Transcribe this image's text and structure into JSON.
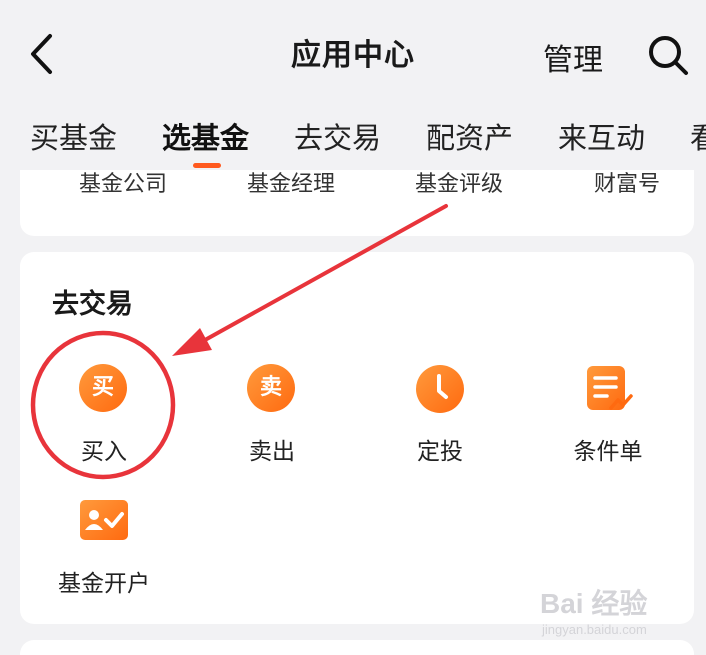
{
  "header": {
    "title": "应用中心",
    "manage_label": "管理"
  },
  "tabs": [
    {
      "label": "买基金",
      "active": false
    },
    {
      "label": "选基金",
      "active": true
    },
    {
      "label": "去交易",
      "active": false
    },
    {
      "label": "配资产",
      "active": false
    },
    {
      "label": "来互动",
      "active": false
    },
    {
      "label": "看",
      "active": false
    }
  ],
  "top_card": {
    "items": [
      "基金公司",
      "基金经理",
      "基金评级",
      "财富号"
    ]
  },
  "trade_section": {
    "title": "去交易",
    "items": [
      {
        "label": "买入",
        "icon_glyph": "买",
        "icon": "buy-icon"
      },
      {
        "label": "卖出",
        "icon_glyph": "卖",
        "icon": "sell-icon"
      },
      {
        "label": "定投",
        "icon": "clock-icon"
      },
      {
        "label": "条件单",
        "icon": "document-chart-icon"
      },
      {
        "label": "基金开户",
        "icon": "account-verified-icon"
      }
    ]
  },
  "watermark": {
    "brand": "Bai 经验",
    "url": "jingyan.baidu.com"
  },
  "colors": {
    "accent": "#ff6a10",
    "annotation": "#e8343b",
    "background": "#f2f2f4"
  }
}
